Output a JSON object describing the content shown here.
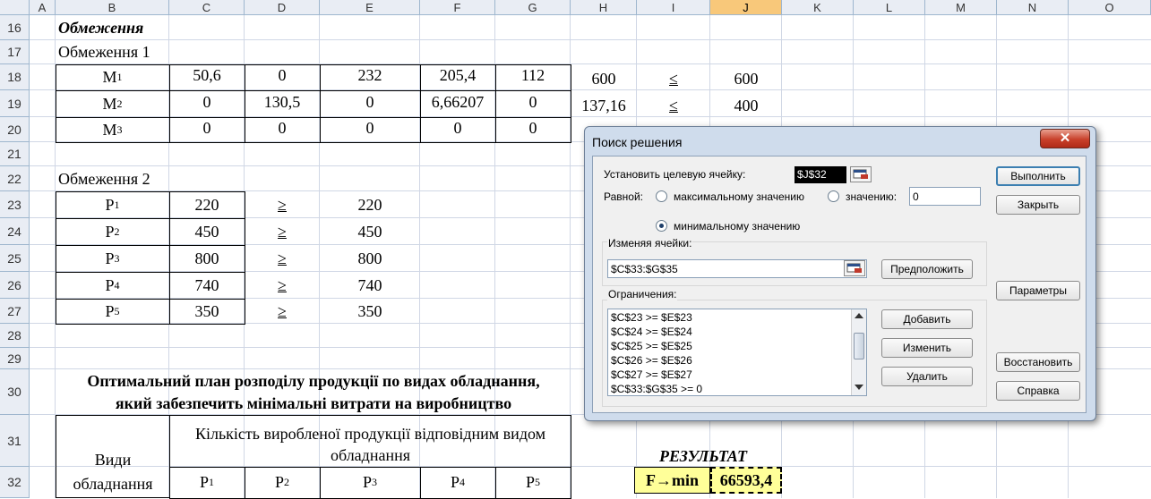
{
  "columns": [
    "A",
    "B",
    "C",
    "D",
    "E",
    "F",
    "G",
    "H",
    "I",
    "J",
    "K",
    "L",
    "M",
    "N",
    "O"
  ],
  "selected_column": "J",
  "rows": [
    "16",
    "17",
    "18",
    "19",
    "20",
    "21",
    "22",
    "23",
    "24",
    "25",
    "26",
    "27",
    "28",
    "29",
    "30",
    "31",
    "32"
  ],
  "sheet": {
    "section_title": "Обмеження",
    "group1_title": "Обмеження 1",
    "m_rows": [
      {
        "label": "M",
        "sub": "1",
        "values": [
          "50,6",
          "0",
          "232",
          "205,4",
          "112"
        ],
        "lhs": "600",
        "op": "≤",
        "rhs": "600"
      },
      {
        "label": "M",
        "sub": "2",
        "values": [
          "0",
          "130,5",
          "0",
          "6,66207",
          "0"
        ],
        "lhs": "137,16",
        "op": "≤",
        "rhs": "400"
      },
      {
        "label": "M",
        "sub": "3",
        "values": [
          "0",
          "0",
          "0",
          "0",
          "0"
        ]
      }
    ],
    "group2_title": "Обмеження 2",
    "p_rows": [
      {
        "label": "P",
        "sub": "1",
        "value": "220",
        "op": "≥",
        "rhs": "220"
      },
      {
        "label": "P",
        "sub": "2",
        "value": "450",
        "op": "≥",
        "rhs": "450"
      },
      {
        "label": "P",
        "sub": "3",
        "value": "800",
        "op": "≥",
        "rhs": "800"
      },
      {
        "label": "P",
        "sub": "4",
        "value": "740",
        "op": "≥",
        "rhs": "740"
      },
      {
        "label": "P",
        "sub": "5",
        "value": "350",
        "op": "≥",
        "rhs": "350"
      }
    ],
    "plan_title_line1": "Оптимальний план розподілу продукції по видах обладнання,",
    "plan_title_line2": "який забезпечить мінімальні витрати на виробництво",
    "kinds_label_line1": "Види",
    "kinds_label_line2": "обладнання",
    "quantity_header_line1": "Кількість виробленої продукції відповідним видом",
    "quantity_header_line2": "обладнання",
    "p_headers": [
      {
        "label": "P",
        "sub": "1"
      },
      {
        "label": "P",
        "sub": "2"
      },
      {
        "label": "P",
        "sub": "3"
      },
      {
        "label": "P",
        "sub": "4"
      },
      {
        "label": "P",
        "sub": "5"
      }
    ],
    "result_label": "РЕЗУЛЬТАТ",
    "fmin_label": "F→min",
    "fmin_value": "66593,4"
  },
  "dialog": {
    "title": "Поиск решения",
    "close": "✕",
    "target_label": "Установить целевую ячейку:",
    "target_value": "$J$32",
    "equal_label": "Равной:",
    "opt_max": "максимальному значению",
    "opt_value": "значению:",
    "value_input": "0",
    "opt_min": "минимальному значению",
    "changing_label": "Изменяя ячейки:",
    "changing_value": "$C$33:$G$35",
    "guess_button": "Предположить",
    "constraints_label": "Ограничения:",
    "constraints": [
      "$C$23 >= $E$23",
      "$C$24 >= $E$24",
      "$C$25 >= $E$25",
      "$C$26 >= $E$26",
      "$C$27 >= $E$27",
      "$C$33:$G$35 >= 0"
    ],
    "add_button": "Добавить",
    "change_button": "Изменить",
    "delete_button": "Удалить",
    "solve_button": "Выполнить",
    "close_button": "Закрыть",
    "options_button": "Параметры",
    "reset_button": "Восстановить",
    "help_button": "Справка"
  }
}
